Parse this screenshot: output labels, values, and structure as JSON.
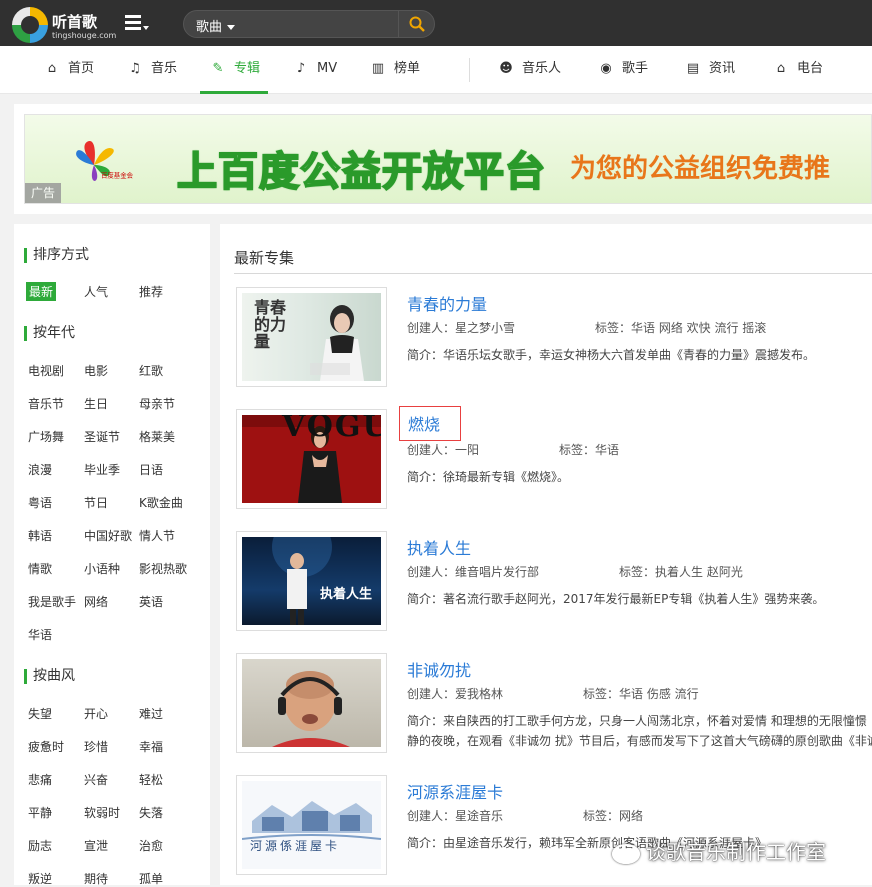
{
  "logo": {
    "name": "听首歌",
    "domain": "tingshouge.com"
  },
  "search": {
    "type": "歌曲",
    "placeholder": ""
  },
  "nav": {
    "items": [
      {
        "label": "首页",
        "icon": "home-icon"
      },
      {
        "label": "音乐",
        "icon": "music-note-icon"
      },
      {
        "label": "专辑",
        "icon": "album-icon"
      },
      {
        "label": "MV",
        "icon": "mv-icon"
      },
      {
        "label": "榜单",
        "icon": "chart-icon"
      },
      {
        "label": "音乐人",
        "icon": "musician-icon"
      },
      {
        "label": "歌手",
        "icon": "singer-icon"
      },
      {
        "label": "资讯",
        "icon": "news-icon"
      },
      {
        "label": "电台",
        "icon": "radio-icon"
      }
    ],
    "active": "专辑"
  },
  "ad": {
    "org": "百度基金会",
    "title": "上百度公益开放平台",
    "subtitle": "为您的公益组织免费推",
    "label": "广告"
  },
  "sidebar": {
    "sort": {
      "heading": "排序方式",
      "items": [
        "最新",
        "人气",
        "推荐"
      ]
    },
    "era": {
      "heading": "按年代",
      "items": [
        "电视剧",
        "电影",
        "红歌",
        "音乐节",
        "生日",
        "母亲节",
        "广场舞",
        "圣诞节",
        "格莱美",
        "浪漫",
        "毕业季",
        "日语",
        "粤语",
        "节日",
        "K歌金曲",
        "韩语",
        "中国好歌",
        "情人节",
        "情歌",
        "小语种",
        "影视热歌",
        "我是歌手",
        "网络",
        "英语",
        "华语"
      ]
    },
    "style": {
      "heading": "按曲风",
      "items": [
        "失望",
        "开心",
        "难过",
        "疲惫时",
        "珍惜",
        "幸福",
        "悲痛",
        "兴奋",
        "轻松",
        "平静",
        "软弱时",
        "失落",
        "励志",
        "宣泄",
        "治愈",
        "叛逆",
        "期待",
        "孤单"
      ]
    }
  },
  "main": {
    "title": "最新专集",
    "albums": [
      {
        "name": "青春的力量",
        "creator": "创建人：星之梦小雪",
        "tags": "标签：华语 网络 欢快 流行 摇滚",
        "desc": "简介：华语乐坛女歌手，幸运女神杨大六首发单曲《青春的力量》震撼发布。",
        "desc2": ""
      },
      {
        "name": "燃烧",
        "creator": "创建人：一阳",
        "tags": "标签：华语",
        "desc": "简介：徐琦最新专辑《燃烧》。",
        "desc2": ""
      },
      {
        "name": "执着人生",
        "creator": "创建人：维音唱片发行部",
        "tags": "标签：执着人生 赵阿光",
        "desc": "简介：著名流行歌手赵阿光，2017年发行最新EP专辑《执着人生》强势来袭。",
        "desc2": ""
      },
      {
        "name": "非诚勿扰",
        "creator": "创建人：爱我格林",
        "tags": "标签：华语 伤感 流行",
        "desc": "简介：来自陕西的打工歌手何方龙，只身一人闯荡北京，怀着对爱情 和理想的无限憧憬",
        "desc2": "静的夜晚，在观看《非诚勿 扰》节目后，有感而发写下了这首大气磅礴的原创歌曲《非诚"
      },
      {
        "name": "河源系涯屋卡",
        "creator": "创建人：星途音乐",
        "tags": "标签：网络",
        "desc": "简介：由星途音乐发行，赖玮军全新原创客语歌曲《河源系涯屋卡》",
        "desc2": ""
      }
    ]
  },
  "cover_texts": {
    "album1": "青春的力量",
    "album2": "VOGUE",
    "album3": "执着人生",
    "album4": "",
    "album5": "河源係涯屋卡"
  },
  "watermark": "谈歌音乐制作工作室",
  "colors": {
    "accent": "#2eaa3a",
    "link": "#2b7bd6",
    "topbar": "#303030",
    "highlight_box": "#e84040"
  }
}
